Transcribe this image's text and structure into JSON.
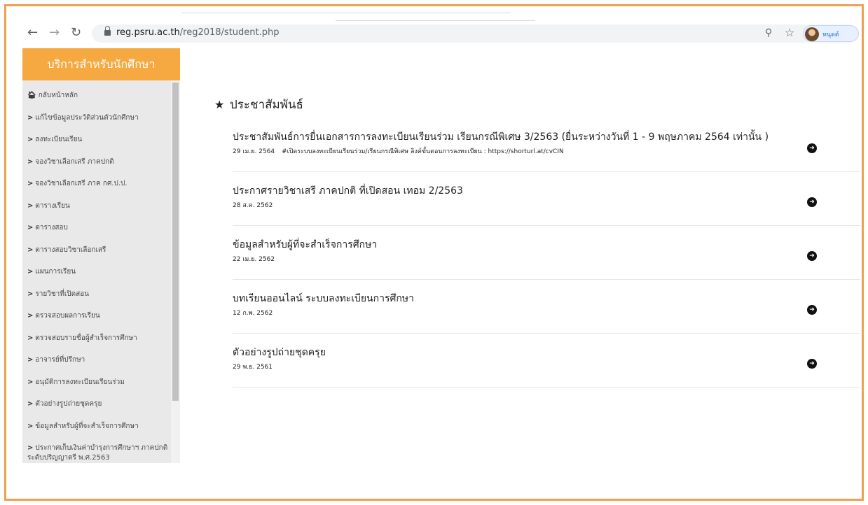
{
  "browser": {
    "url_host": "reg.psru.ac.th",
    "url_path": "/reg2018/student.php",
    "profile_name": "หนุดต์"
  },
  "sidebar": {
    "title": "บริการสำหรับนักศึกษา",
    "home_label": "กลับหน้าหลัก",
    "items": [
      "แก้ไขข้อมูลประวัติส่วนตัวนักศึกษา",
      "ลงทะเบียนเรียน",
      "จองวิชาเลือกเสรี ภาคปกติ",
      "จองวิชาเลือกเสรี ภาค กศ.ป.ป.",
      "ตารางเรียน",
      "ตารางสอบ",
      "ตารางสอบวิชาเลือกเสรี",
      "แผนการเรียน",
      "รายวิชาที่เปิดสอน",
      "ตรวจสอบผลการเรียน",
      "ตรวจสอบรายชื่อผู้สำเร็จการศึกษา",
      "อาจารย์ที่ปรึกษา",
      "อนุมัติการลงทะเบียนเรียนร่วม",
      "ตัวอย่างรูปถ่ายชุดครุย",
      "ข้อมูลสำหรับผู้ที่จะสำเร็จการศึกษา",
      "ประกาศเก็บเงินค่าบำรุงการศึกษาฯ ภาคปกติ ระดับปริญญาตรี พ.ศ.2563"
    ]
  },
  "main": {
    "section_title": "ประชาสัมพันธ์",
    "news": [
      {
        "title": "ประชาสัมพันธ์การยื่นเอกสารการลงทะเบียนเรียนร่วม เรียนกรณีพิเศษ 3/2563 (ยื่นระหว่างวันที่ 1 - 9 พฤษภาคม 2564 เท่านั้น )",
        "date": "29 เม.ย. 2564",
        "desc": "#เปิดระบบลงทะเบียนเรียนร่วม/เรียนกรณีพิเศษ ลิงค์ขั้นตอนการลงทะเบียน : https://shorturl.at/cvCIN"
      },
      {
        "title": "ประกาศรายวิชาเสรี ภาคปกติ ที่เปิดสอน เทอม 2/2563",
        "date": "28 ส.ค. 2562",
        "desc": ""
      },
      {
        "title": "ข้อมูลสำหรับผู้ที่จะสำเร็จการศึกษา",
        "date": "22 เม.ย. 2562",
        "desc": ""
      },
      {
        "title": "บทเรียนออนไลน์ ระบบลงทะเบียนการศึกษา",
        "date": "12 ก.พ. 2562",
        "desc": ""
      },
      {
        "title": "ตัวอย่างรูปถ่ายชุดครุย",
        "date": "29 พ.ย. 2561",
        "desc": ""
      }
    ]
  }
}
